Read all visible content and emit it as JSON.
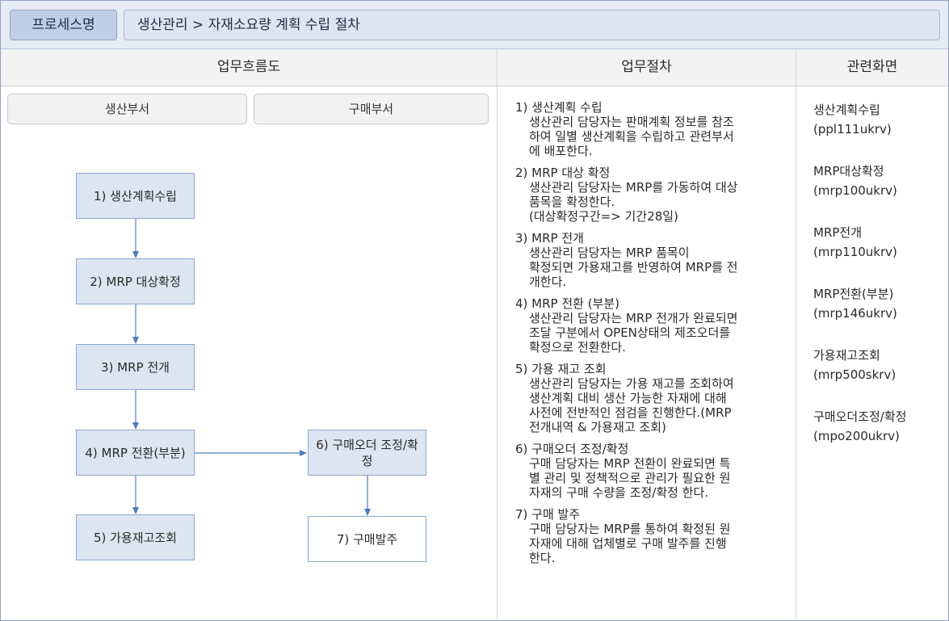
{
  "header": {
    "label": "프로세스명",
    "path": "생산관리 > 자재소요량 계획 수립 절차"
  },
  "columns": {
    "flow": "업무흐름도",
    "procedure": "업무절차",
    "screens": "관련화면"
  },
  "departments": {
    "production": "생산부서",
    "purchasing": "구매부서"
  },
  "flow_boxes": {
    "b1": "1) 생산계획수립",
    "b2": "2) MRP 대상확정",
    "b3": "3) MRP 전개",
    "b4": "4) MRP 전환(부분)",
    "b5": "5) 가용재고조회",
    "b6": "6) 구매오더 조정/확정",
    "b7": "7) 구매발주"
  },
  "steps": [
    {
      "title": "1) 생산계획 수립",
      "desc": "생산관리 담당자는 판매계획 정보를 참조\n하여 일별 생산계획을 수립하고 관련부서\n에 배포한다."
    },
    {
      "title": "2) MRP 대상 확정",
      "desc": "생산관리 담당자는 MRP를 가동하여 대상\n품목을 확정한다.\n(대상확정구간=> 기간28일)"
    },
    {
      "title": "3) MRP 전개",
      "desc": "생산관리 담당자는 MRP 품목이\n확정되면 가용재고를 반영하여 MRP를 전\n개한다."
    },
    {
      "title": "4) MRP 전환 (부분)",
      "desc": "생산관리 담당자는 MRP 전개가 완료되면\n조달 구분에서 OPEN상태의 제조오더를\n확정으로 전환한다."
    },
    {
      "title": "5) 가용 재고 조회",
      "desc": "생산관리 담당자는 가용 재고를 조회하여\n생산계획 대비 생산 가능한 자재에 대해\n사전에 전반적인 점검을 진행한다.(MRP\n전개내역 & 가용재고 조회)"
    },
    {
      "title": "6) 구매오더 조정/확정",
      "desc": "구매 담당자는 MRP 전환이 완료되면 특\n별 관리 및 정책적으로 관리가 필요한 원\n자재의 구매 수량을 조정/확정 한다."
    },
    {
      "title": "7) 구매 발주",
      "desc": "구매 담당자는 MRP를 통하여 확정된 원\n자재에 대해 업체별로 구매 발주를 진행\n한다."
    }
  ],
  "screens": [
    {
      "name": "생산계획수립",
      "code": "(ppl111ukrv)"
    },
    {
      "name": "MRP대상확정",
      "code": "(mrp100ukrv)"
    },
    {
      "name": "MRP전개",
      "code": "(mrp110ukrv)"
    },
    {
      "name": "MRP전환(부분)",
      "code": "(mrp146ukrv)"
    },
    {
      "name": "가용재고조회",
      "code": "(mrp500skrv)"
    },
    {
      "name": "구매오더조정/확정",
      "code": "(mpo200ukrv)"
    }
  ]
}
